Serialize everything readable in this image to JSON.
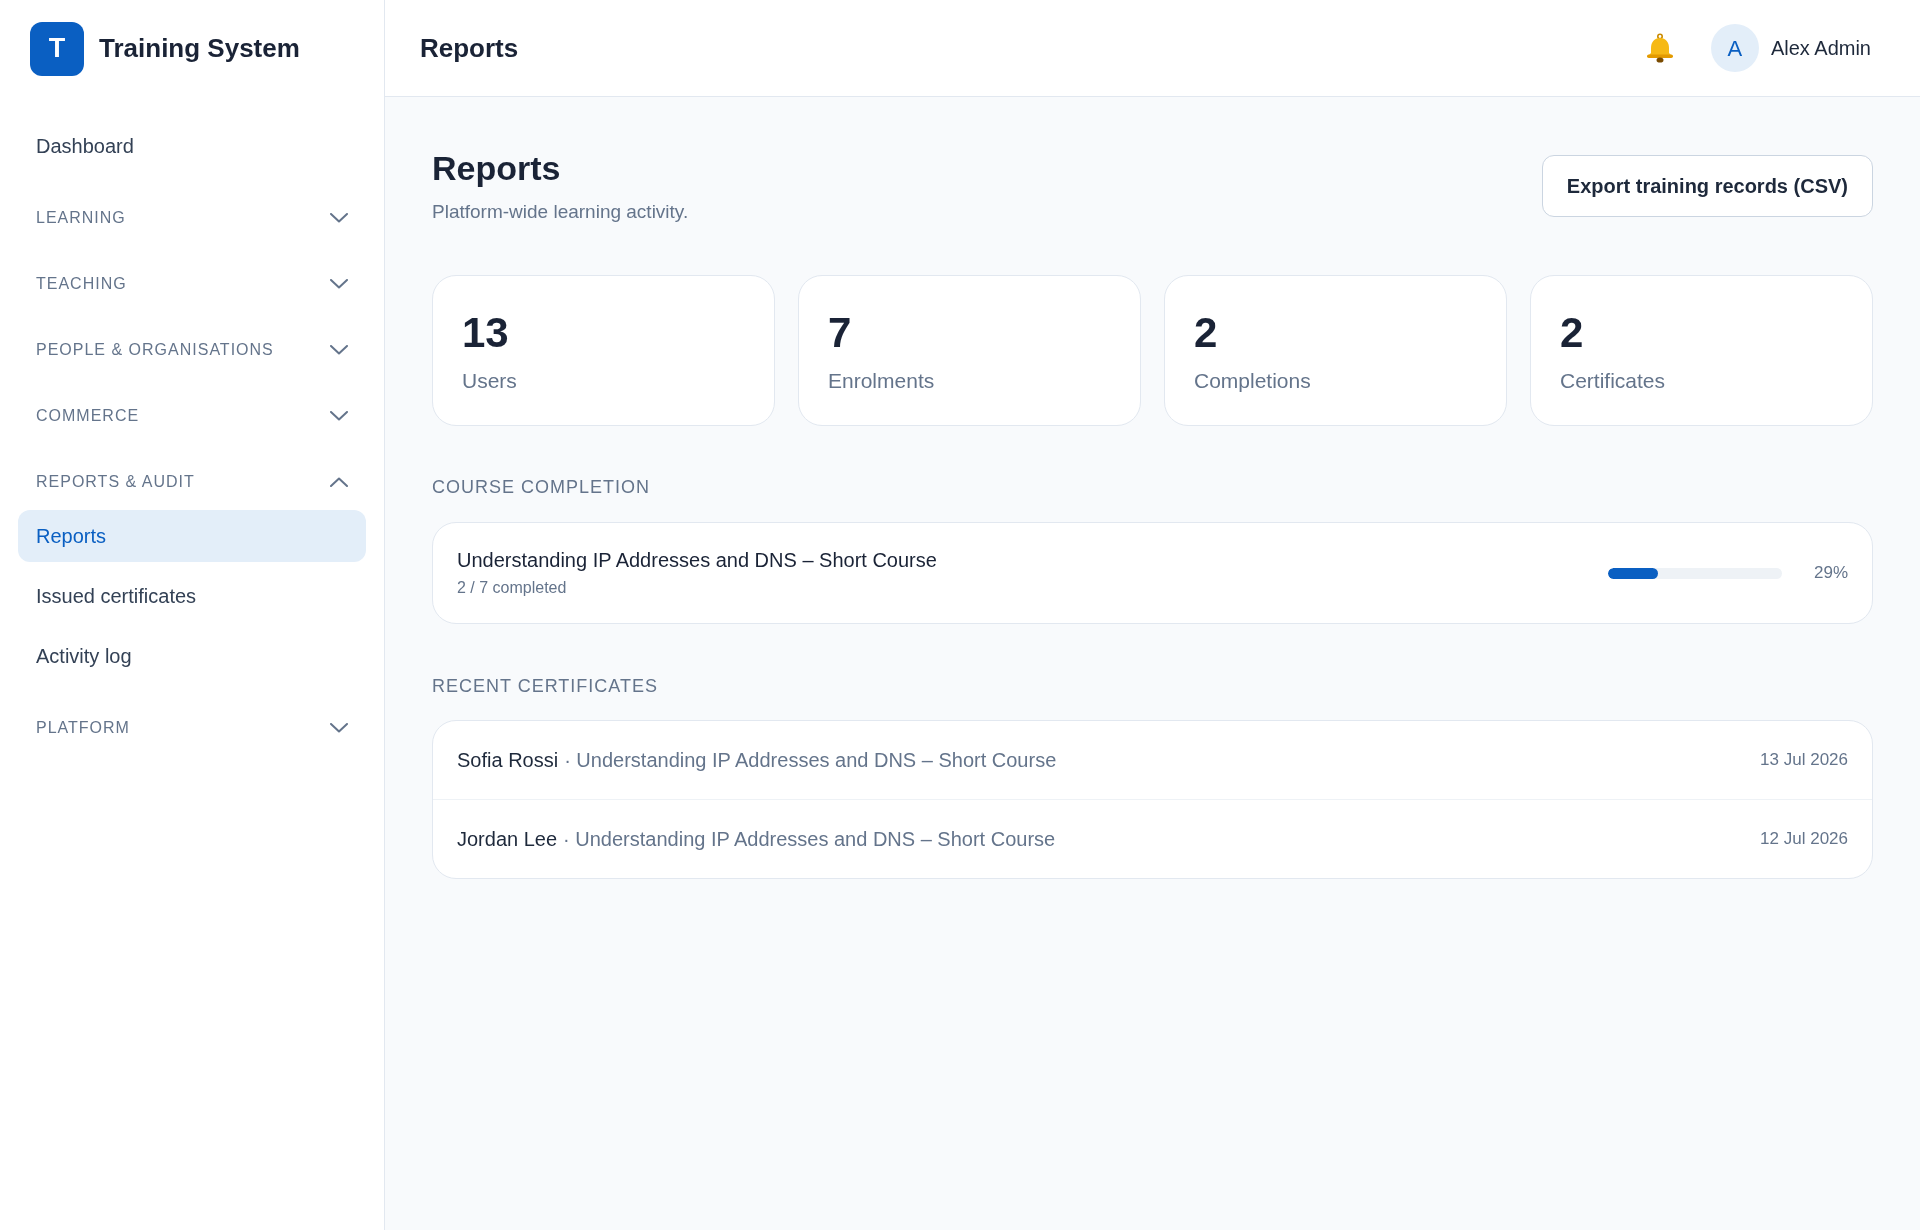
{
  "sidebar": {
    "logo": {
      "letter": "T",
      "title": "Training System"
    },
    "items": [
      {
        "kind": "link",
        "label": "Dashboard",
        "selected": false
      },
      {
        "kind": "section",
        "label": "LEARNING",
        "expanded": false
      },
      {
        "kind": "section",
        "label": "TEACHING",
        "expanded": false
      },
      {
        "kind": "section",
        "label": "PEOPLE & ORGANISATIONS",
        "expanded": false
      },
      {
        "kind": "section",
        "label": "COMMERCE",
        "expanded": false
      },
      {
        "kind": "section",
        "label": "REPORTS & AUDIT",
        "expanded": true,
        "children": [
          {
            "label": "Reports",
            "selected": true
          },
          {
            "label": "Issued certificates",
            "selected": false
          },
          {
            "label": "Activity log",
            "selected": false
          }
        ]
      },
      {
        "kind": "section",
        "label": "PLATFORM",
        "expanded": false
      }
    ]
  },
  "header": {
    "title": "Reports",
    "user": {
      "initial": "A",
      "name": "Alex Admin"
    }
  },
  "page": {
    "title": "Reports",
    "subtitle": "Platform-wide learning activity.",
    "export_button": "Export training records (CSV)"
  },
  "stats": [
    {
      "value": "13",
      "label": "Users"
    },
    {
      "value": "7",
      "label": "Enrolments"
    },
    {
      "value": "2",
      "label": "Completions"
    },
    {
      "value": "2",
      "label": "Certificates"
    }
  ],
  "course_completion": {
    "heading": "COURSE COMPLETION",
    "courses": [
      {
        "title": "Understanding IP Addresses and DNS – Short Course",
        "completed": "2 / 7 completed",
        "level": 0.29,
        "percent": "29%"
      }
    ]
  },
  "recent_certificates": {
    "heading": "RECENT CERTIFICATES",
    "rows": [
      {
        "name": "Sofia Rossi",
        "separator": "·",
        "course": "Understanding IP Addresses and DNS – Short Course",
        "date": "13 Jul 2026"
      },
      {
        "name": "Jordan Lee",
        "separator": "·",
        "course": "Understanding IP Addresses and DNS – Short Course",
        "date": "12 Jul 2026"
      }
    ]
  }
}
